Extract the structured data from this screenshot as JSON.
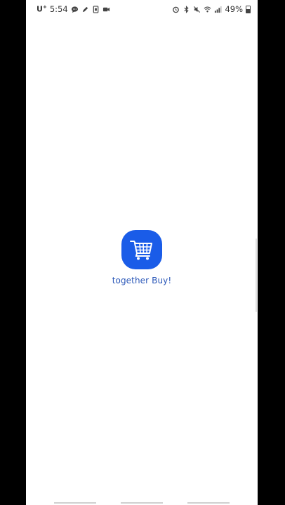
{
  "status_bar": {
    "carrier": "U",
    "carrier_sup": "+",
    "time": "5:54",
    "battery_percent": "49%",
    "battery_level": 0.49,
    "left_icons": [
      "chat-bubble-icon",
      "pen-icon",
      "sim-icon",
      "video-camera-icon"
    ],
    "right_icons": [
      "alarm-icon",
      "bluetooth-icon",
      "mute-icon",
      "wifi-icon",
      "signal-icon",
      "battery-icon"
    ]
  },
  "splash": {
    "icon": "shopping-cart-icon",
    "icon_color": "#1a5ce8",
    "app_name": "together Buy!",
    "app_name_color": "#2a57b8"
  }
}
